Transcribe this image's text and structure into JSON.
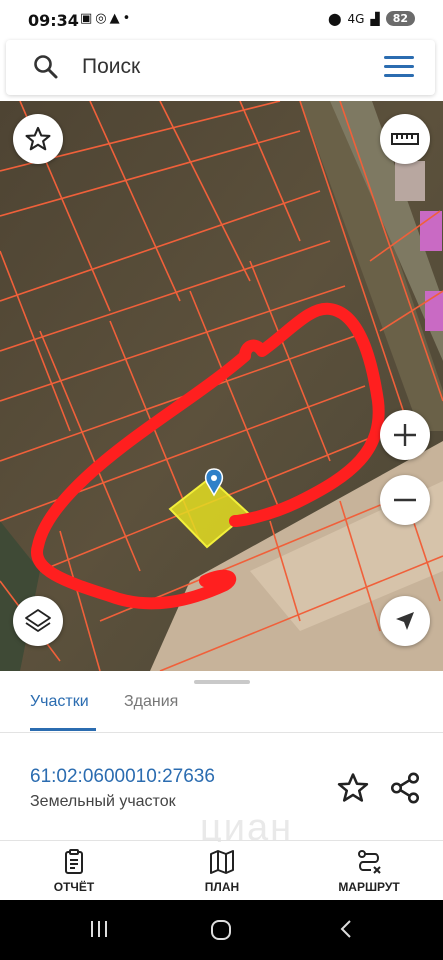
{
  "status": {
    "time": "09:34",
    "icons": [
      "screen-record-icon",
      "whatsapp-icon",
      "alert-icon",
      "dot-icon"
    ],
    "network": "4G",
    "battery": "82"
  },
  "search": {
    "placeholder": "Поиск"
  },
  "sheet": {
    "tabs": [
      {
        "label": "Участки",
        "active": true
      },
      {
        "label": "Здания",
        "active": false
      }
    ],
    "parcel": {
      "number": "61:02:0600010:27636",
      "type": "Земельный участок"
    },
    "watermark": "циан"
  },
  "bottom_nav": [
    {
      "label": "ОТЧЁТ",
      "icon": "report-icon"
    },
    {
      "label": "ПЛАН",
      "icon": "map-plan-icon"
    },
    {
      "label": "МАРШРУТ",
      "icon": "route-icon"
    }
  ],
  "colors": {
    "accent": "#2b6cb0",
    "parcel_lines": "#f0603a",
    "annotation": "#ff1f1f",
    "highlight": "#e3dd22"
  }
}
